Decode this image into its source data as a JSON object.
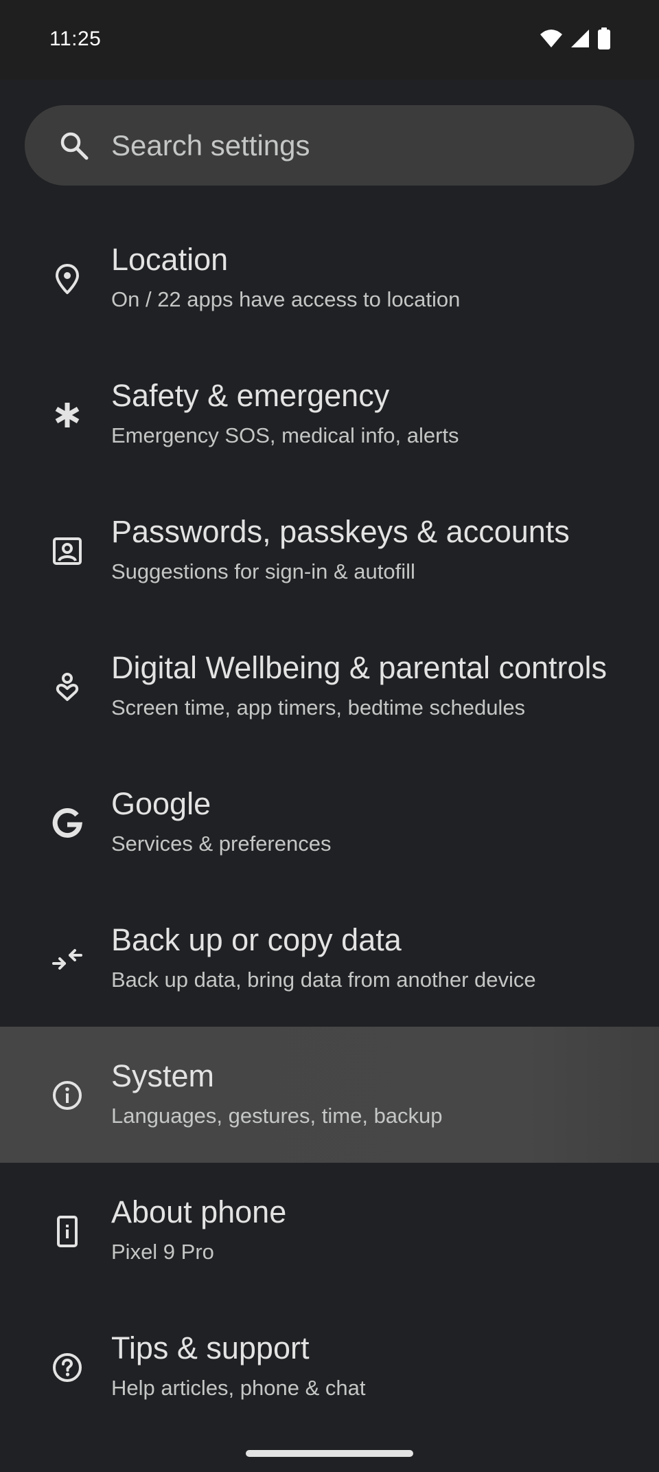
{
  "status_bar": {
    "time": "11:25",
    "icons": [
      "wifi-icon",
      "cellular-signal-icon",
      "battery-icon"
    ]
  },
  "search": {
    "placeholder": "Search settings",
    "icon": "search-icon"
  },
  "settings": [
    {
      "id": "location",
      "icon": "location-pin-icon",
      "title": "Location",
      "subtitle": "On / 22 apps have access to location"
    },
    {
      "id": "safety",
      "icon": "asterisk-icon",
      "title": "Safety & emergency",
      "subtitle": "Emergency SOS, medical info, alerts"
    },
    {
      "id": "passwords",
      "icon": "account-box-icon",
      "title": "Passwords, passkeys & accounts",
      "subtitle": "Suggestions for sign-in & autofill"
    },
    {
      "id": "wellbeing",
      "icon": "wellbeing-heart-icon",
      "title": "Digital Wellbeing & parental controls",
      "subtitle": "Screen time, app timers, bedtime schedules"
    },
    {
      "id": "google",
      "icon": "google-g-icon",
      "title": "Google",
      "subtitle": "Services & preferences"
    },
    {
      "id": "backup",
      "icon": "transfer-arrows-icon",
      "title": "Back up or copy data",
      "subtitle": "Back up data, bring data from another device"
    },
    {
      "id": "system",
      "icon": "info-circle-icon",
      "title": "System",
      "subtitle": "Languages, gestures, time, backup"
    },
    {
      "id": "about",
      "icon": "phone-info-icon",
      "title": "About phone",
      "subtitle": "Pixel 9 Pro"
    },
    {
      "id": "tips",
      "icon": "help-circle-icon",
      "title": "Tips & support",
      "subtitle": "Help articles, phone & chat"
    }
  ],
  "colors": {
    "background": "#202124",
    "status_bar": "#1f1f1f",
    "search_bar": "#3c3c3c",
    "highlight_row": "#464646",
    "title_text": "#e3e3e3",
    "subtitle_text": "#c4c7c5"
  }
}
